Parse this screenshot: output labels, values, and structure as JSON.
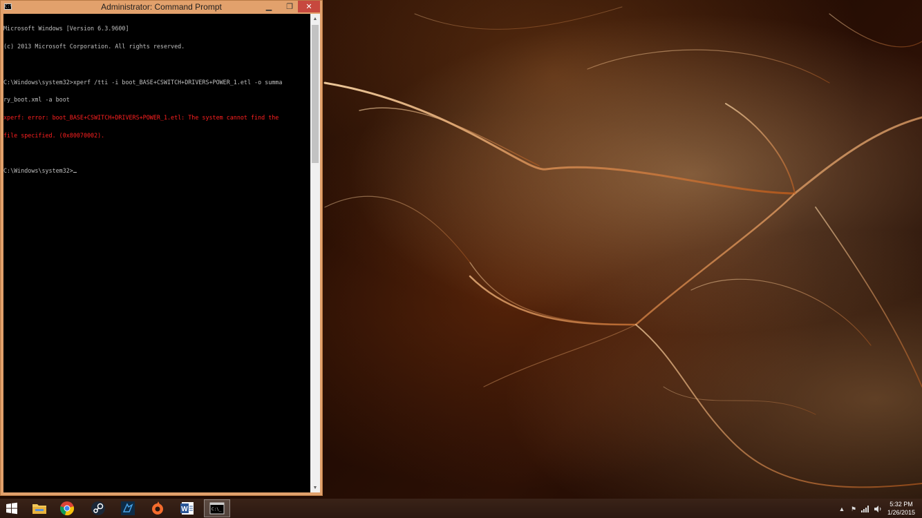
{
  "window": {
    "title": "Administrator: Command Prompt",
    "icon_label": "C:\\",
    "minimize_glyph": "▁",
    "restore_glyph": "❐",
    "close_glyph": "✕"
  },
  "console": {
    "lines": [
      {
        "text": "Microsoft Windows [Version 6.3.9600]",
        "kind": "normal"
      },
      {
        "text": "(c) 2013 Microsoft Corporation. All rights reserved.",
        "kind": "normal"
      },
      {
        "text": "",
        "kind": "normal"
      },
      {
        "text": "C:\\Windows\\system32>xperf /tti -i boot_BASE+CSWITCH+DRIVERS+POWER_1.etl -o summa",
        "kind": "normal"
      },
      {
        "text": "ry_boot.xml -a boot",
        "kind": "normal"
      },
      {
        "text": "xperf: error: boot_BASE+CSWITCH+DRIVERS+POWER_1.etl: The system cannot find the",
        "kind": "error"
      },
      {
        "text": "file specified. (0x80070002).",
        "kind": "error"
      },
      {
        "text": "",
        "kind": "normal"
      },
      {
        "text": "C:\\Windows\\system32>",
        "kind": "prompt"
      }
    ],
    "text_color": "#c0c0c0",
    "error_color": "#ff2020"
  },
  "taskbar": {
    "items": [
      {
        "name": "start-button",
        "icon": "windows-logo-icon"
      },
      {
        "name": "file-explorer-button",
        "icon": "folder-icon"
      },
      {
        "name": "chrome-button",
        "icon": "chrome-icon"
      },
      {
        "name": "steam-button",
        "icon": "steam-icon"
      },
      {
        "name": "app-button",
        "icon": "blue-app-icon"
      },
      {
        "name": "origin-button",
        "icon": "origin-icon"
      },
      {
        "name": "word-button",
        "icon": "word-icon",
        "label": "W"
      },
      {
        "name": "command-prompt-button",
        "icon": "cmd-icon",
        "label": "C:\\_"
      }
    ],
    "tray": {
      "show_hidden_glyph": "▲",
      "flag_glyph": "⚑",
      "network_glyph": "▂▄▆",
      "volume_glyph": "🔈"
    },
    "clock": {
      "time": "5:32 PM",
      "date": "1/26/2015"
    }
  },
  "colors": {
    "window_frame": "#e2a16c",
    "close_button": "#c7483e",
    "taskbar": "#2b1810"
  }
}
